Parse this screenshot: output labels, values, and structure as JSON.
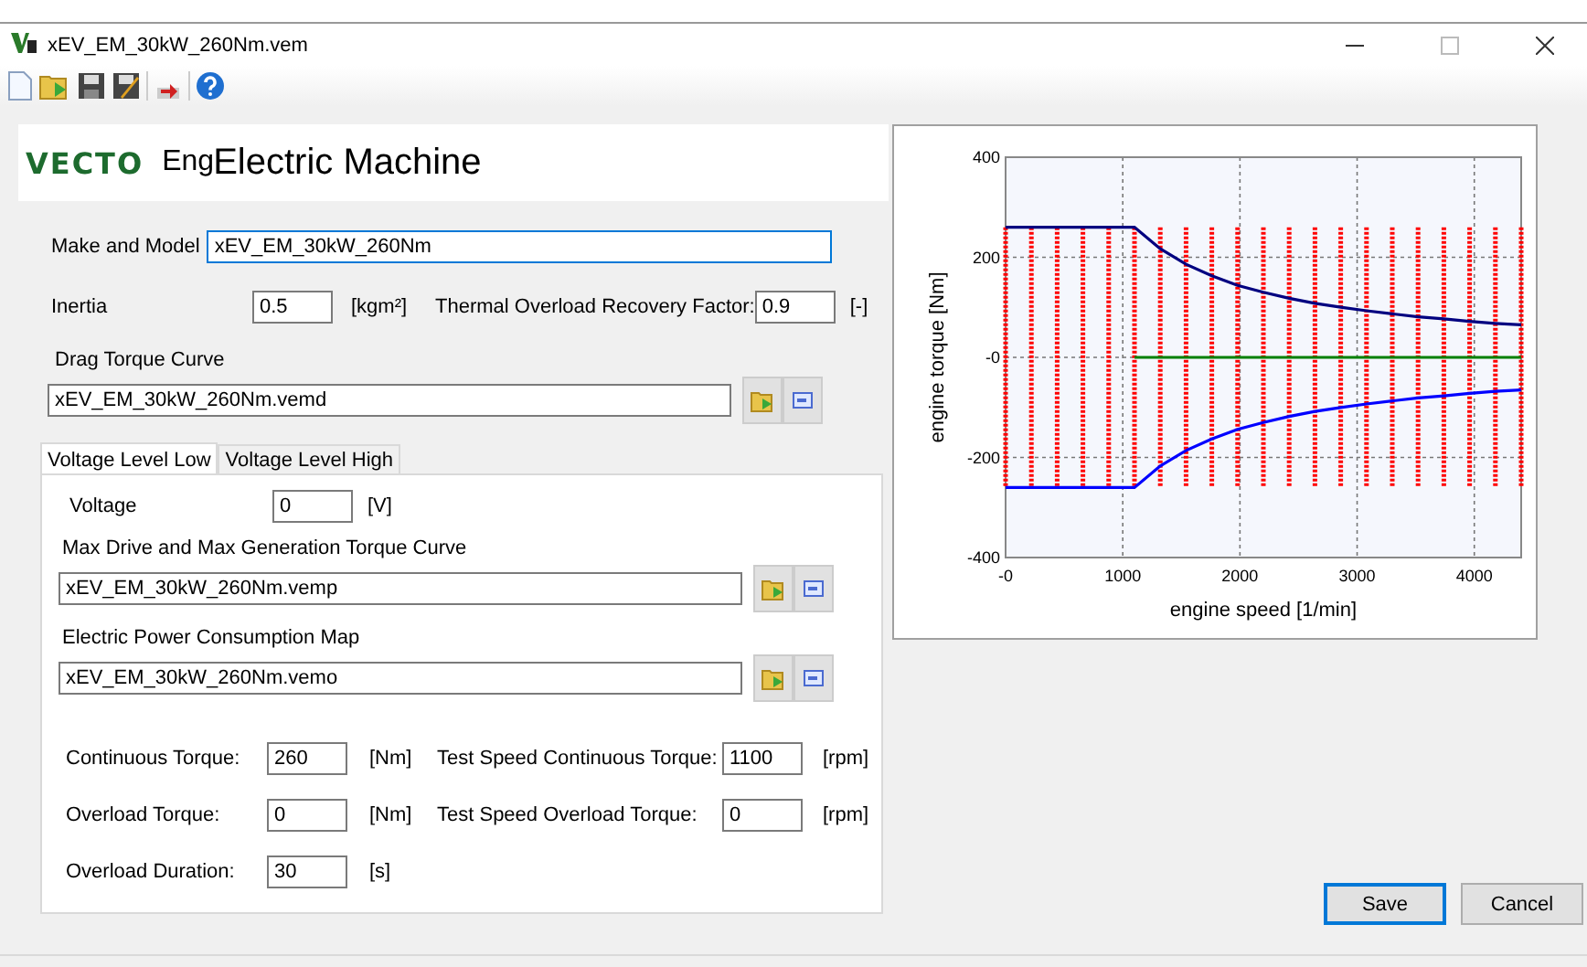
{
  "window": {
    "title": "xEV_EM_30kW_260Nm.vem"
  },
  "header": {
    "logo": "VECTO",
    "cut_title": "Eng",
    "title": "Electric Machine"
  },
  "make_and_model": {
    "label": "Make and Model",
    "value": "xEV_EM_30kW_260Nm"
  },
  "inertia": {
    "label": "Inertia",
    "value": "0.5",
    "unit": "[kgm²]"
  },
  "thermal_factor": {
    "label": "Thermal Overload Recovery Factor:",
    "value": "0.9",
    "unit": "[-]"
  },
  "drag_torque_curve": {
    "label": "Drag Torque Curve",
    "value": "xEV_EM_30kW_260Nm.vemd"
  },
  "tabs": [
    {
      "label": "Voltage Level Low",
      "selected": true
    },
    {
      "label": "Voltage Level High",
      "selected": false
    }
  ],
  "voltage": {
    "label": "Voltage",
    "value": "0",
    "unit": "[V]"
  },
  "files": [
    {
      "label": "Max Drive and Max Generation Torque Curve",
      "value": "xEV_EM_30kW_260Nm.vemp"
    },
    {
      "label": "Electric Power Consumption Map",
      "value": "xEV_EM_30kW_260Nm.vemo"
    }
  ],
  "params": [
    {
      "label": "Continuous Torque:",
      "value": "260",
      "unit": "[Nm]"
    },
    {
      "label": "Test Speed Continuous Torque:",
      "value": "1100",
      "unit": "[rpm]"
    },
    {
      "label": "Overload Torque:",
      "value": "0",
      "unit": "[Nm]"
    },
    {
      "label": "Test Speed Overload Torque:",
      "value": "0",
      "unit": "[rpm]"
    },
    {
      "label": "Overload Duration:",
      "value": "30",
      "unit": "[s]"
    }
  ],
  "chart": {
    "chart_data": {
      "type": "line",
      "xlabel": "engine speed [1/min]",
      "ylabel": "engine torque [Nm]",
      "xlim": [
        0,
        4400
      ],
      "ylim": [
        -400,
        400
      ],
      "xticks": [
        {
          "value": 0,
          "label": "-0"
        },
        1000,
        2000,
        3000,
        4000
      ],
      "yticks": [
        400,
        200,
        {
          "value": 0,
          "label": "-0"
        },
        -200,
        -400
      ],
      "x": [
        0,
        220,
        440,
        660,
        880,
        1100,
        1320,
        1540,
        1760,
        1980,
        2200,
        2420,
        2640,
        2860,
        3080,
        3300,
        3520,
        3740,
        3960,
        4180,
        4400
      ],
      "grid": true,
      "ref_lines": [
        {
          "axis": "x",
          "value": 0,
          "color": "#ff0000",
          "line_style": "dotted"
        },
        {
          "axis": "x",
          "value": 220,
          "color": "#ff0000",
          "line_style": "dotted"
        },
        {
          "axis": "x",
          "value": 440,
          "color": "#ff0000",
          "line_style": "dotted"
        },
        {
          "axis": "x",
          "value": 660,
          "color": "#ff0000",
          "line_style": "dotted"
        },
        {
          "axis": "x",
          "value": 880,
          "color": "#ff0000",
          "line_style": "dotted"
        },
        {
          "axis": "x",
          "value": 1100,
          "color": "#ff0000",
          "line_style": "dotted"
        },
        {
          "axis": "x",
          "value": 1320,
          "color": "#ff0000",
          "line_style": "dotted"
        },
        {
          "axis": "x",
          "value": 1540,
          "color": "#ff0000",
          "line_style": "dotted"
        },
        {
          "axis": "x",
          "value": 1760,
          "color": "#ff0000",
          "line_style": "dotted"
        },
        {
          "axis": "x",
          "value": 1980,
          "color": "#ff0000",
          "line_style": "dotted"
        },
        {
          "axis": "x",
          "value": 2200,
          "color": "#ff0000",
          "line_style": "dotted"
        },
        {
          "axis": "x",
          "value": 2420,
          "color": "#ff0000",
          "line_style": "dotted"
        },
        {
          "axis": "x",
          "value": 2640,
          "color": "#ff0000",
          "line_style": "dotted"
        },
        {
          "axis": "x",
          "value": 2860,
          "color": "#ff0000",
          "line_style": "dotted"
        },
        {
          "axis": "x",
          "value": 3080,
          "color": "#ff0000",
          "line_style": "dotted"
        },
        {
          "axis": "x",
          "value": 3300,
          "color": "#ff0000",
          "line_style": "dotted"
        },
        {
          "axis": "x",
          "value": 3520,
          "color": "#ff0000",
          "line_style": "dotted"
        },
        {
          "axis": "x",
          "value": 3740,
          "color": "#ff0000",
          "line_style": "dotted"
        },
        {
          "axis": "x",
          "value": 3960,
          "color": "#ff0000",
          "line_style": "dotted"
        },
        {
          "axis": "x",
          "value": 4180,
          "color": "#ff0000",
          "line_style": "dotted"
        },
        {
          "axis": "x",
          "value": 4400,
          "color": "#ff0000",
          "line_style": "dotted"
        }
      ],
      "series": [
        {
          "color": "#000080",
          "values": [
            260,
            260,
            260,
            260,
            260,
            260,
            217,
            186,
            163,
            144,
            130,
            118,
            108,
            100,
            93,
            87,
            81,
            77,
            72,
            68,
            65
          ]
        },
        {
          "color": "#0000ff",
          "values": [
            -260,
            -260,
            -260,
            -260,
            -260,
            -260,
            -217,
            -186,
            -163,
            -144,
            -130,
            -118,
            -108,
            -100,
            -93,
            -87,
            -81,
            -77,
            -72,
            -68,
            -65
          ]
        },
        {
          "color": "#008000",
          "values": [
            null,
            null,
            null,
            null,
            null,
            0,
            0,
            0,
            0,
            0,
            0,
            0,
            0,
            0,
            0,
            0,
            0,
            0,
            0,
            0,
            0
          ]
        }
      ]
    }
  },
  "buttons": [
    {
      "label": "Save",
      "default": true
    },
    {
      "label": "Cancel",
      "default": false
    }
  ]
}
